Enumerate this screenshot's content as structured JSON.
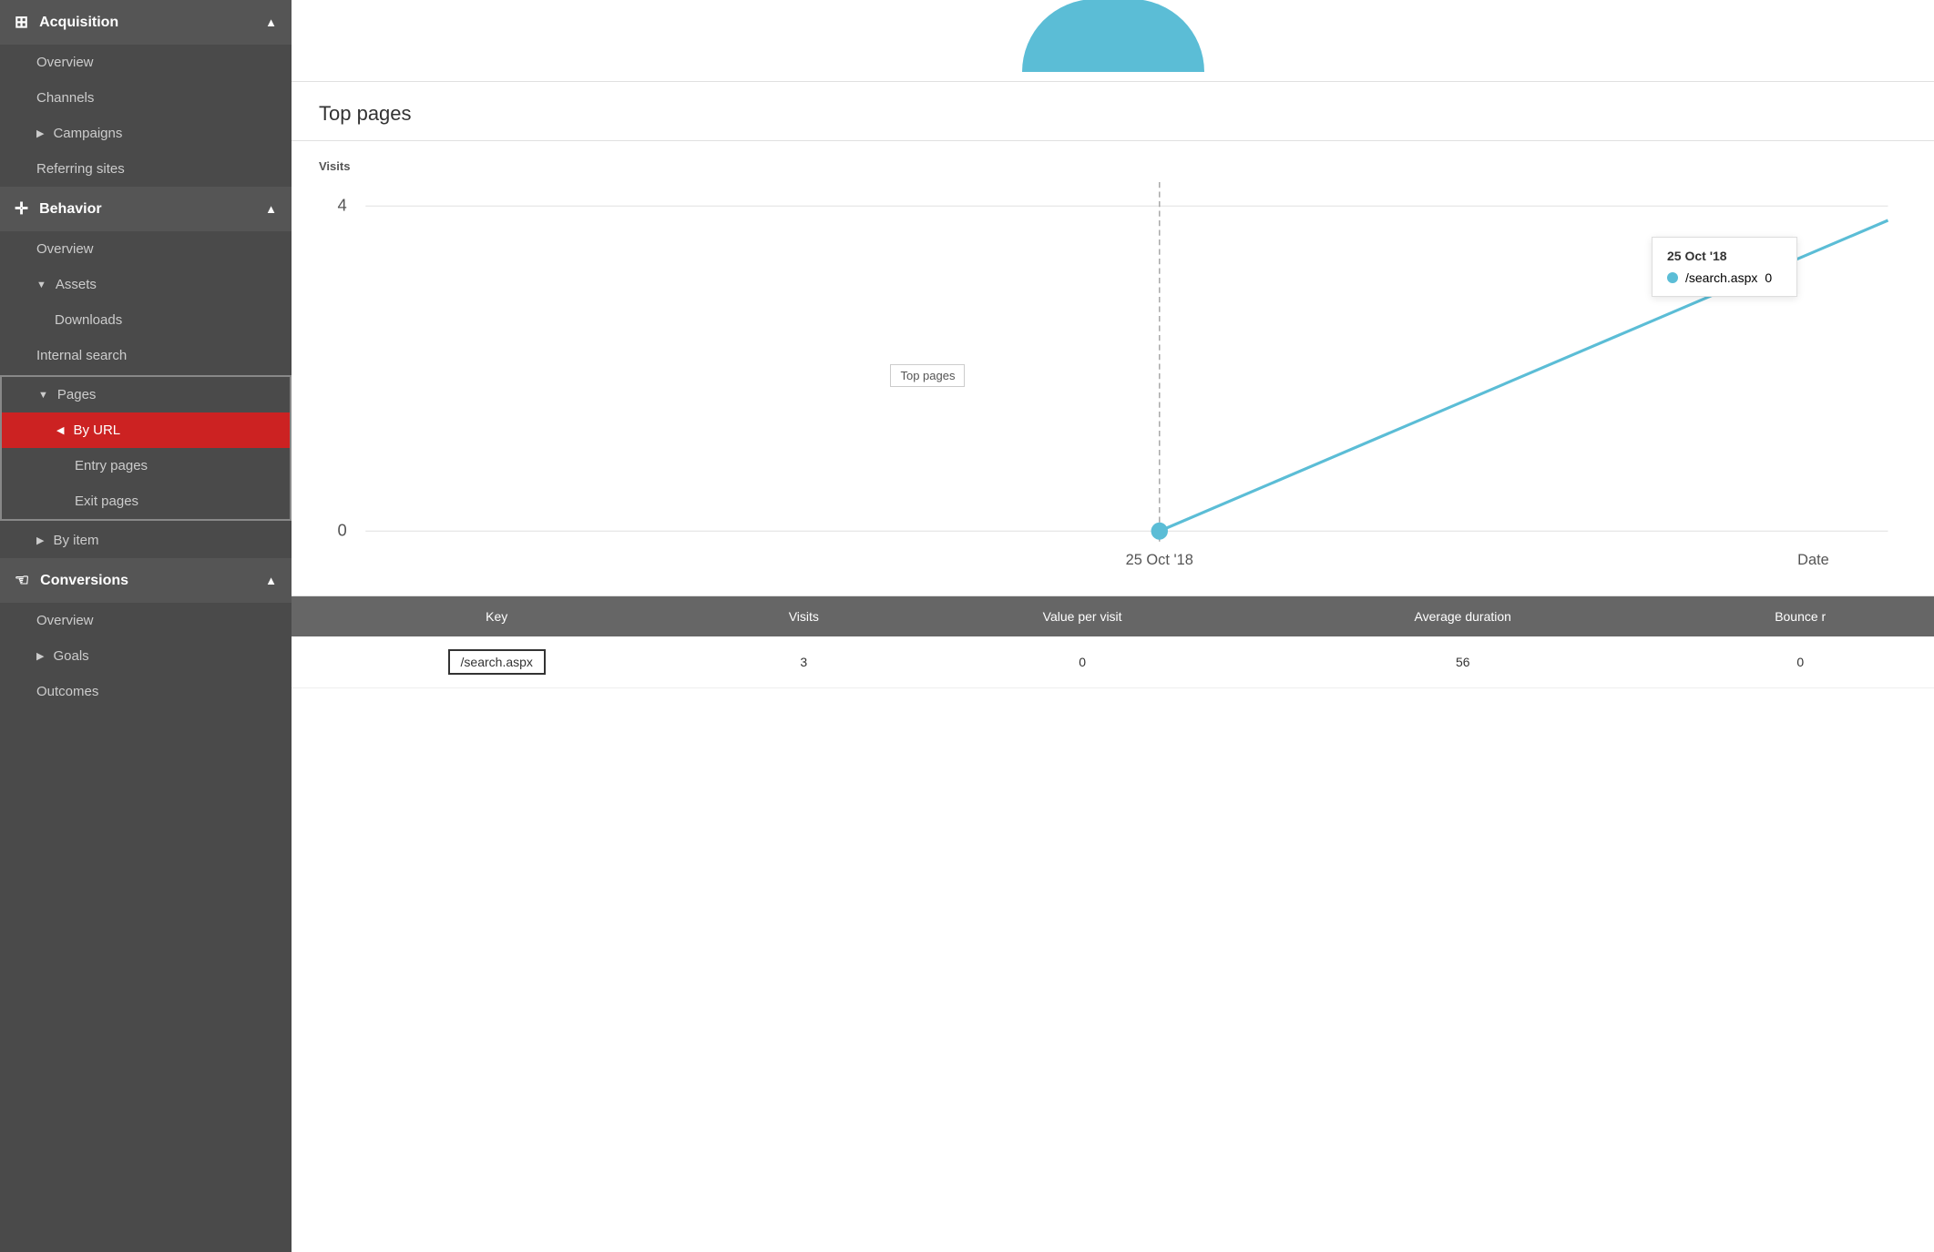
{
  "sidebar": {
    "sections": [
      {
        "id": "acquisition",
        "icon": "⊞",
        "label": "Acquisition",
        "chevron": "▲",
        "items": [
          {
            "id": "acq-overview",
            "label": "Overview",
            "indent": 1,
            "arrow": false
          },
          {
            "id": "acq-channels",
            "label": "Channels",
            "indent": 1,
            "arrow": false
          },
          {
            "id": "acq-campaigns",
            "label": "Campaigns",
            "indent": 1,
            "arrow": true,
            "arrowDir": "right"
          },
          {
            "id": "acq-referring",
            "label": "Referring sites",
            "indent": 1,
            "arrow": false
          }
        ]
      },
      {
        "id": "behavior",
        "icon": "✛",
        "label": "Behavior",
        "chevron": "▲",
        "items": [
          {
            "id": "beh-overview",
            "label": "Overview",
            "indent": 1,
            "arrow": false
          },
          {
            "id": "beh-assets",
            "label": "Assets",
            "indent": 1,
            "arrow": true,
            "arrowDir": "down",
            "expanded": true
          },
          {
            "id": "beh-downloads",
            "label": "Downloads",
            "indent": 2,
            "arrow": false
          },
          {
            "id": "beh-internal-search",
            "label": "Internal search",
            "indent": 1,
            "arrow": false
          },
          {
            "id": "beh-pages",
            "label": "Pages",
            "indent": 1,
            "arrow": true,
            "arrowDir": "down",
            "expanded": true,
            "outlined": true
          },
          {
            "id": "beh-by-url",
            "label": "By URL",
            "indent": 2,
            "arrow": true,
            "arrowDir": "left",
            "active": true
          },
          {
            "id": "beh-entry-pages",
            "label": "Entry pages",
            "indent": 3,
            "arrow": false
          },
          {
            "id": "beh-exit-pages",
            "label": "Exit pages",
            "indent": 3,
            "arrow": false
          },
          {
            "id": "beh-by-item",
            "label": "By item",
            "indent": 1,
            "arrow": true,
            "arrowDir": "right"
          }
        ]
      },
      {
        "id": "conversions",
        "icon": "☜",
        "label": "Conversions",
        "chevron": "▲",
        "items": [
          {
            "id": "conv-overview",
            "label": "Overview",
            "indent": 1,
            "arrow": false
          },
          {
            "id": "conv-goals",
            "label": "Goals",
            "indent": 1,
            "arrow": true,
            "arrowDir": "right"
          },
          {
            "id": "conv-outcomes",
            "label": "Outcomes",
            "indent": 1,
            "arrow": false
          }
        ]
      }
    ]
  },
  "main": {
    "section_title": "Top pages",
    "chart": {
      "y_axis_label": "Visits",
      "y_max": 4,
      "y_zero": 0,
      "x_label": "Date",
      "x_point_label": "25 Oct '18",
      "data_point_y": 0,
      "line_label": "Top pages",
      "tooltip": {
        "date": "25 Oct '18",
        "item_label": "/search.aspx",
        "item_value": "0"
      }
    },
    "table": {
      "columns": [
        "Key",
        "Visits",
        "Value per visit",
        "Average duration",
        "Bounce r"
      ],
      "rows": [
        {
          "key": "/search.aspx",
          "visits": "3",
          "value_per_visit": "0",
          "average_duration": "56",
          "bounce_rate": "0"
        }
      ]
    }
  }
}
